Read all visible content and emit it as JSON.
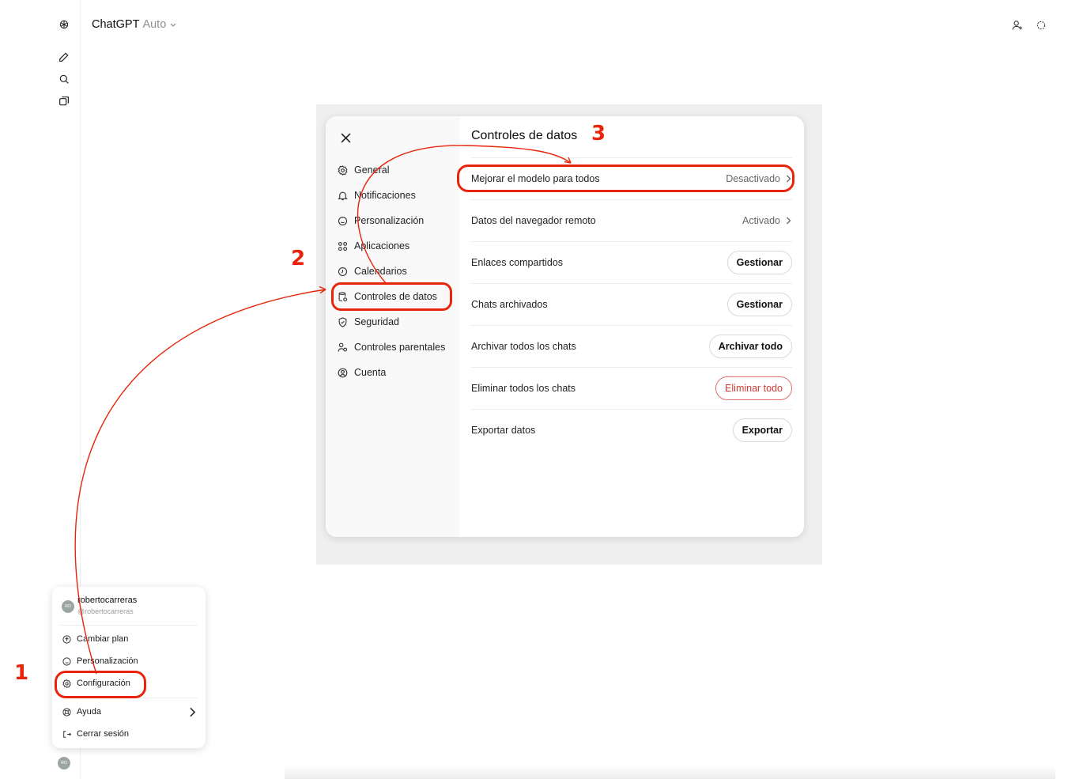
{
  "header": {
    "title": "ChatGPT",
    "model": "Auto"
  },
  "modal": {
    "title": "Controles de datos",
    "nav": [
      {
        "label": "General",
        "icon": "gear-icon"
      },
      {
        "label": "Notificaciones",
        "icon": "bell-icon"
      },
      {
        "label": "Personalización",
        "icon": "personalization-icon"
      },
      {
        "label": "Aplicaciones",
        "icon": "apps-icon"
      },
      {
        "label": "Calendarios",
        "icon": "clock-icon"
      },
      {
        "label": "Controles de datos",
        "icon": "database-icon"
      },
      {
        "label": "Seguridad",
        "icon": "shield-icon"
      },
      {
        "label": "Controles parentales",
        "icon": "parental-icon"
      },
      {
        "label": "Cuenta",
        "icon": "account-icon"
      }
    ],
    "rows": [
      {
        "label": "Mejorar el modelo para todos",
        "value": "Desactivado"
      },
      {
        "label": "Datos del navegador remoto",
        "value": "Activado"
      },
      {
        "label": "Enlaces compartidos",
        "button": "Gestionar"
      },
      {
        "label": "Chats archivados",
        "button": "Gestionar"
      },
      {
        "label": "Archivar todos los chats",
        "button": "Archivar todo"
      },
      {
        "label": "Eliminar todos los chats",
        "button": "Eliminar todo"
      },
      {
        "label": "Exportar datos",
        "button": "Exportar"
      }
    ]
  },
  "user_menu": {
    "name": "robertocarreras",
    "handle": "@robertocarreras",
    "avatar_initials": "RO",
    "items": [
      {
        "label": "Cambiar plan"
      },
      {
        "label": "Personalización"
      },
      {
        "label": "Configuración"
      },
      {
        "label": "Ayuda"
      },
      {
        "label": "Cerrar sesión"
      }
    ]
  },
  "annotations": {
    "step1": "1",
    "step2": "2",
    "step3": "3",
    "color": "#e8250c"
  }
}
